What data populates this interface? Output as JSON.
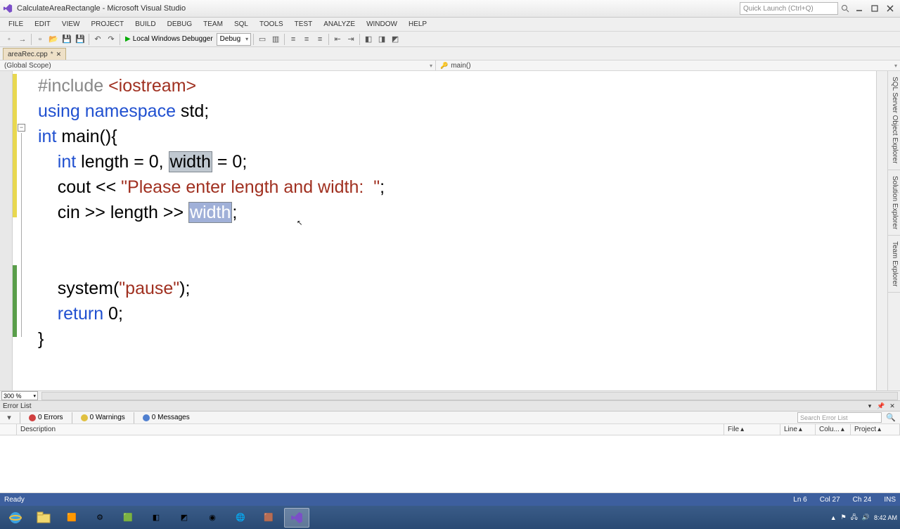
{
  "window": {
    "title": "CalculateAreaRectangle - Microsoft Visual Studio",
    "quick_launch_placeholder": "Quick Launch (Ctrl+Q)"
  },
  "menu": [
    "FILE",
    "EDIT",
    "VIEW",
    "PROJECT",
    "BUILD",
    "DEBUG",
    "TEAM",
    "SQL",
    "TOOLS",
    "TEST",
    "ANALYZE",
    "WINDOW",
    "HELP"
  ],
  "toolbar": {
    "debugger_label": "Local Windows Debugger",
    "config": "Debug"
  },
  "tab": {
    "name": "areaRec.cpp",
    "dirty": "*"
  },
  "scope": {
    "left": "(Global Scope)",
    "right_icon": "🔑",
    "right": "main()"
  },
  "zoom": "300 %",
  "code": {
    "l1_pre": "#include ",
    "l1_inc": "<iostream>",
    "l2_a": "using",
    "l2_b": " ",
    "l2_c": "namespace",
    "l2_d": " std;",
    "l3_a": "int",
    "l3_b": " main(){",
    "l4_pre": "    ",
    "l4_a": "int",
    "l4_b": " length = 0, ",
    "l4_hl": "width",
    "l4_c": " = 0;",
    "l5_pre": "    cout << ",
    "l5_str": "\"Please enter length and width:  \"",
    "l5_end": ";",
    "l6_pre": "    cin >> length >> ",
    "l6_sel": "width",
    "l6_end": ";",
    "l7": "",
    "l8": "",
    "l9_pre": "    system(",
    "l9_str": "\"pause\"",
    "l9_end": ");",
    "l10_pre": "    ",
    "l10_a": "return",
    "l10_b": " 0;",
    "l11": "}"
  },
  "side_tabs": [
    "SQL Server Object Explorer",
    "Solution Explorer",
    "Team Explorer"
  ],
  "error_panel": {
    "title": "Error List",
    "errors": "0 Errors",
    "warnings": "0 Warnings",
    "messages": "0 Messages",
    "search_placeholder": "Search Error List",
    "cols": {
      "desc": "Description",
      "file": "File",
      "line": "Line",
      "col": "Colu...",
      "project": "Project"
    }
  },
  "status": {
    "ready": "Ready",
    "ln": "Ln 6",
    "col": "Col 27",
    "ch": "Ch 24",
    "ins": "INS"
  },
  "tray": {
    "time": "8:42 AM",
    "date": ""
  }
}
